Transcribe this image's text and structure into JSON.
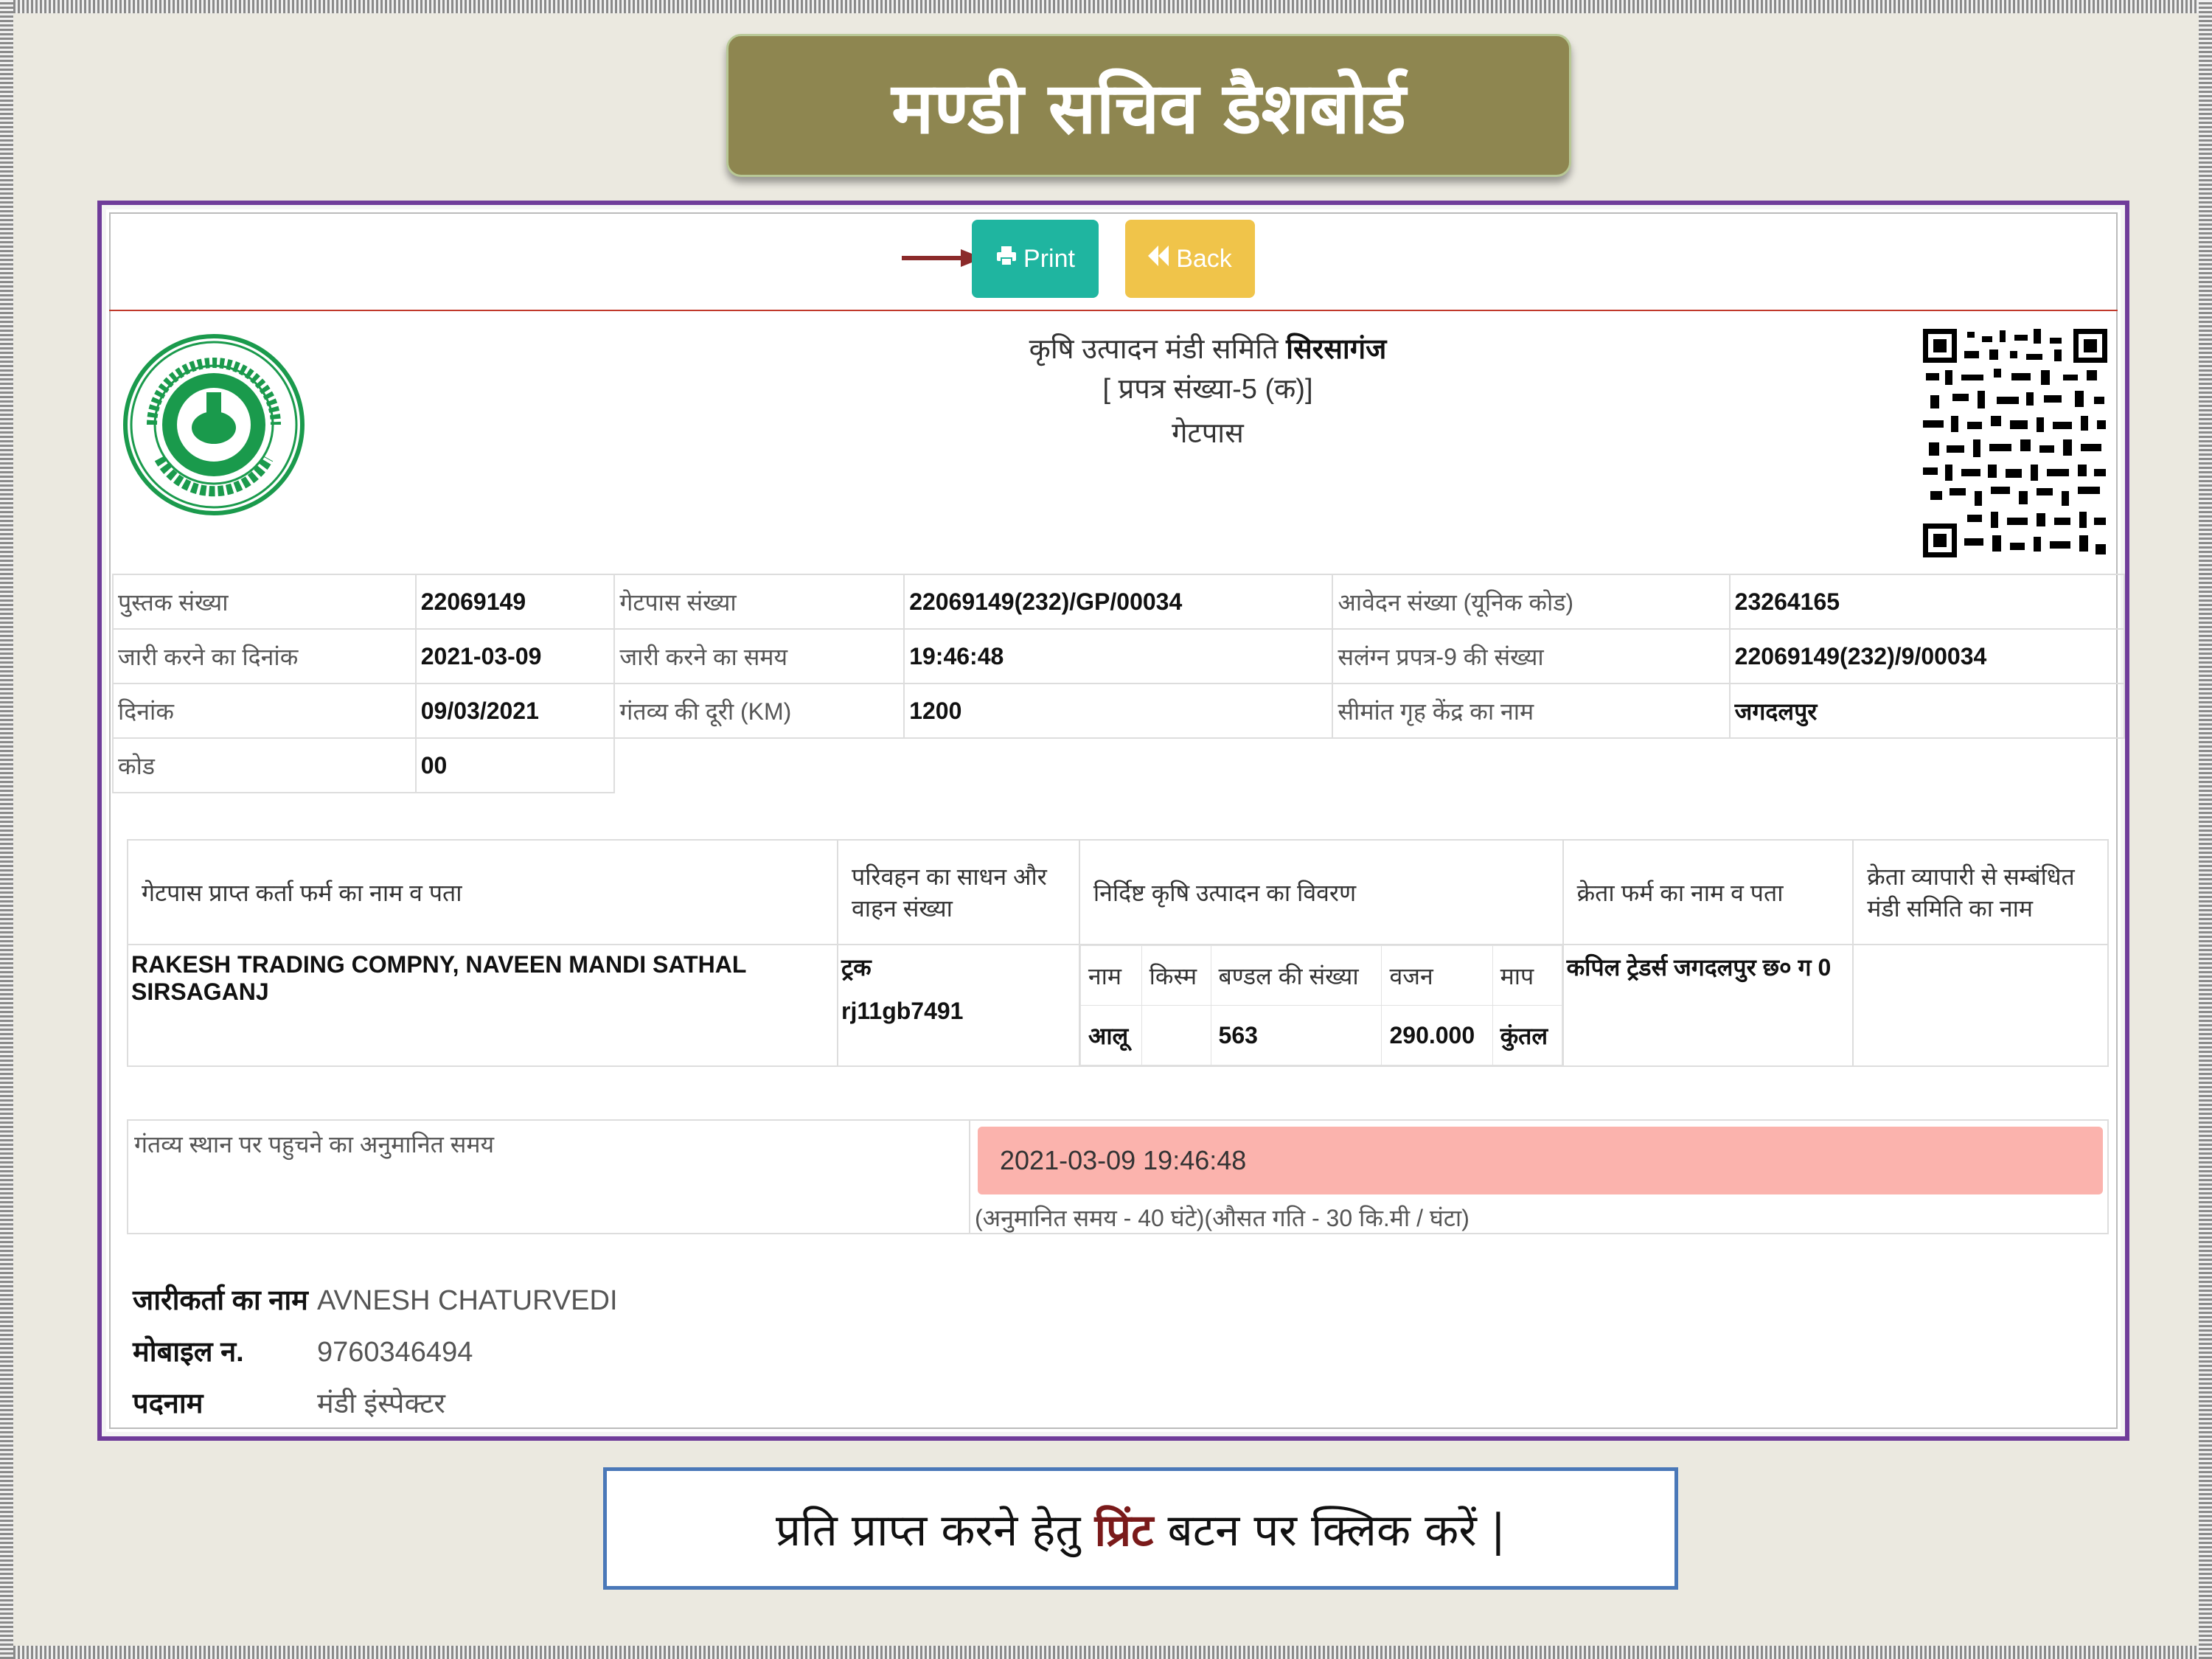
{
  "slide": {
    "title": "मण्डी सचिव डैशबोर्ड",
    "caption_before": "प्रति प्राप्त करने हेतु ",
    "caption_highlight": "प्रिंट",
    "caption_after": " बटन पर क्लिक करें |"
  },
  "toolbar": {
    "print_label": "Print",
    "back_label": "Back",
    "print_icon": "printer-icon",
    "back_icon": "double-chevron-left-icon"
  },
  "header": {
    "line1_prefix": "कृषि उत्पादन मंडी समिति ",
    "line1_bold": "सिरसागंज",
    "line2": "[ प्रपत्र संख्या-5 (क)]",
    "line3": "गेटपास"
  },
  "info": {
    "book_no_label": "पुस्तक संख्या",
    "book_no": "22069149",
    "gatepass_no_label": "गेटपास संख्या",
    "gatepass_no": "22069149(232)/GP/00034",
    "application_no_label": "आवेदन संख्या (यूनिक कोड)",
    "application_no": "23264165",
    "issue_date_label": "जारी करने का दिनांक",
    "issue_date": "2021-03-09",
    "issue_time_label": "जारी करने का समय",
    "issue_time": "19:46:48",
    "form9_label": "सलंग्न प्रपत्र-9 की संख्या",
    "form9": "22069149(232)/9/00034",
    "date_label": "दिनांक",
    "date": "09/03/2021",
    "distance_label": "गंतव्य की दूरी (KM)",
    "distance": "1200",
    "border_center_label": "सीमांत गृह केंद्र का नाम",
    "border_center": "जगदलपुर",
    "code_label": "कोड",
    "code": "00"
  },
  "goods": {
    "headers": [
      "गेटपास प्राप्त कर्ता फर्म का नाम व पता",
      "परिवहन का साधन और वाहन संख्या",
      "निर्दिष्ट कृषि उत्पादन का विवरण",
      "क्रेता फर्म का नाम व पता",
      "क्रेता व्यापारी से सम्बंधित मंडी समिति का नाम"
    ],
    "firm": "RAKESH TRADING COMPNY, NAVEEN MANDI SATHAL SIRSAGANJ",
    "vehicle_type": "ट्रक",
    "vehicle_no": "rj11gb7491",
    "sub_headers": [
      "नाम",
      "किस्म",
      "बण्डल की संख्या",
      "वजन",
      "माप"
    ],
    "item": {
      "name": "आलू",
      "variety": "",
      "bundles": "563",
      "weight": "290.000",
      "unit": "कुंतल"
    },
    "buyer": "कपिल ट्रेडर्स जगदलपुर छ० ग 0",
    "buyer_mandi": ""
  },
  "eta": {
    "label": "गंतव्य स्थान पर पहुचने का अनुमानित समय",
    "value": "2021-03-09 19:46:48",
    "note": "(अनुमानित समय - 40 घंटे)(औसत गति - 30 कि.मी / घंटा)"
  },
  "issuer": {
    "name_label": "जारीकर्ता का नाम",
    "name": "AVNESH CHATURVEDI",
    "mobile_label": "मोबाइल न.",
    "mobile": "9760346494",
    "designation_label": "पदनाम",
    "designation": "मंडी इंस्पेक्टर"
  },
  "colors": {
    "title_bg": "#8e8650",
    "panel_border": "#6f3c9a",
    "print_btn": "#1fb5a0",
    "back_btn": "#f0c44a",
    "eta_bg": "#fbb3ad",
    "caption_border": "#4a78b8",
    "arrow": "#8b2a2a"
  }
}
